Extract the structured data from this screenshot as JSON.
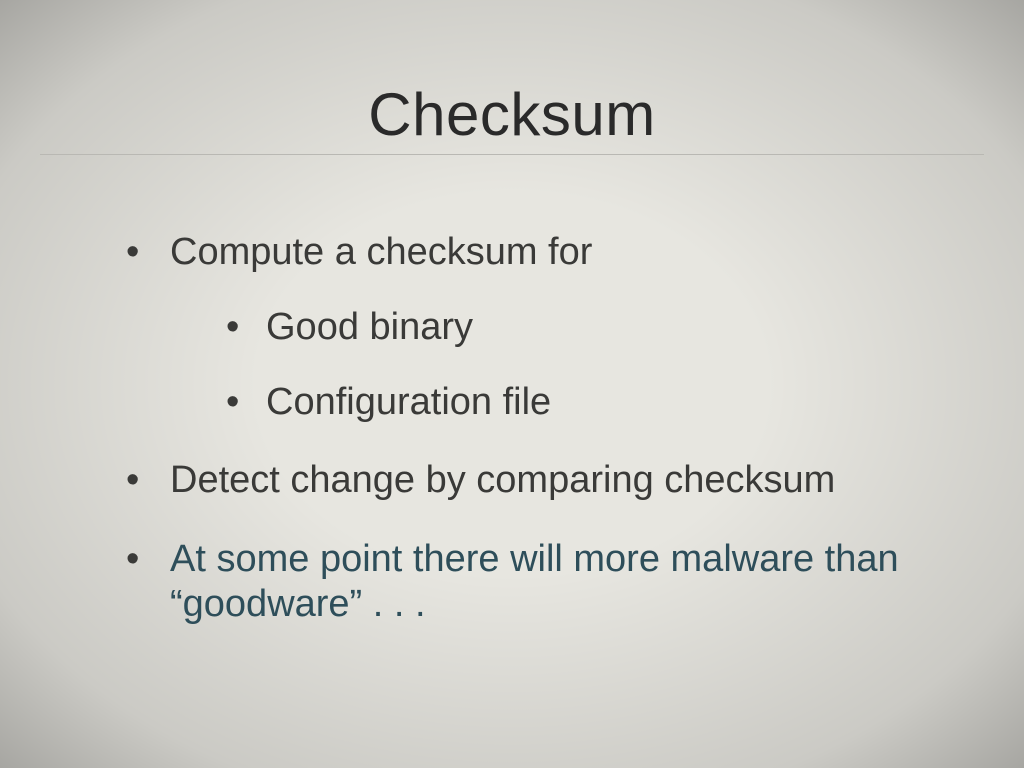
{
  "slide": {
    "title": "Checksum",
    "bullets": [
      {
        "text": "Compute a checksum for",
        "highlight": false,
        "sub": [
          {
            "text": "Good binary"
          },
          {
            "text": "Configuration file"
          }
        ]
      },
      {
        "text": "Detect change by comparing checksum",
        "highlight": false
      },
      {
        "text": "At some point there will more malware than “goodware” . . .",
        "highlight": true
      }
    ]
  }
}
